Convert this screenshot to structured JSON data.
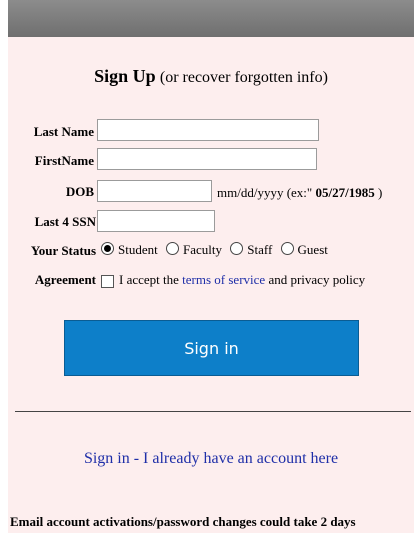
{
  "form": {
    "title": "Sign Up",
    "subtitle": "(or recover forgotten info)",
    "last_name_label": "Last Name",
    "last_name_value": "",
    "first_name_label": "FirstName",
    "first_name_value": "",
    "dob_label": "DOB",
    "dob_value": "",
    "dob_hint_prefix": "mm/dd/yyyy (ex:\"",
    "dob_hint_example": "05/27/1985",
    "dob_hint_suffix": ")",
    "ssn_label": "Last 4 SSN",
    "ssn_value": "",
    "status_label": "Your Status",
    "status_options": [
      "Student",
      "Faculty",
      "Staff",
      "Guest"
    ],
    "status_selected": "Student",
    "agreement_label": "Agreement",
    "agreement_text_prefix": "I accept the",
    "agreement_link": "terms of service",
    "agreement_text_suffix": "and privacy policy",
    "agreement_checked": false,
    "submit_label": "Sign in",
    "signin_link": "Sign in - I already have an account here",
    "footer_note": "Email account activations/password changes could take 2 days"
  },
  "colors": {
    "background": "#fdeeee",
    "button": "#0d7fc9",
    "link": "#1f2fa8",
    "topbar": "#7c7c7c"
  }
}
